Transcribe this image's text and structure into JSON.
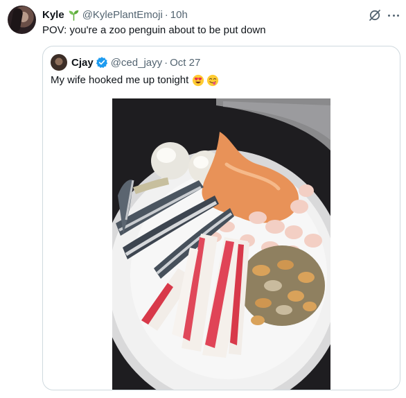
{
  "tweet": {
    "author_name": "Kyle",
    "author_handle": "@KylePlantEmoji",
    "separator": "·",
    "time": "10h",
    "text": "POV: you're a zoo penguin about to be put down"
  },
  "quoted": {
    "author_name": "Cjay",
    "author_handle": "@ced_jayy",
    "separator": "·",
    "date": "Oct 27",
    "text": "My wife hooked me up tonight",
    "emojis": [
      "heart-eyes-emoji",
      "yum-face-emoji"
    ]
  },
  "icons": {
    "sprout": "sprout-icon",
    "grok": "grok-icon",
    "more": "more-icon",
    "verified": "verified-badge-icon"
  },
  "colors": {
    "verified_blue": "#1d9bf0",
    "secondary_text": "#536471",
    "border": "#cfd9de",
    "sprout_green": "#5dad3c"
  }
}
